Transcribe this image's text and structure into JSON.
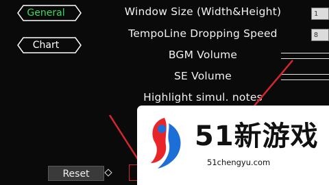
{
  "tabs": {
    "general_label": "General",
    "chart_label": "Chart"
  },
  "settings": {
    "window_size_label": "Window Size (Width&Height)",
    "window_size_value": "1",
    "tempoline_label": "TempoLine Dropping Speed",
    "tempoline_value": "8",
    "bgm_label": "BGM Volume",
    "se_label": "SE Volume",
    "highlight_label": "Highlight simul. notes"
  },
  "footer": {
    "reset_label": "Reset"
  },
  "watermark": {
    "brand": "51新游戏",
    "domain": "51chengyu.com"
  },
  "colors": {
    "background": "#0a0a0a",
    "active_tab": "#3ddc5c",
    "annotation_red": "#d7262e"
  }
}
